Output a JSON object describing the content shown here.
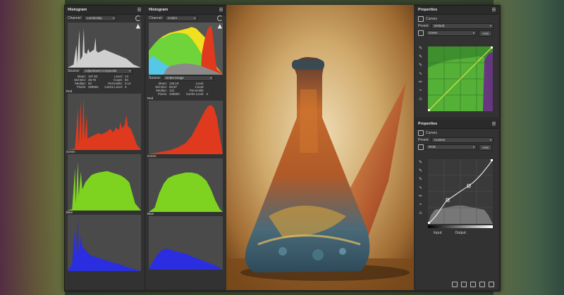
{
  "left_hist": {
    "title": "Histogram",
    "channel_label": "Channel:",
    "channel_value": "Luminosity",
    "source_label": "Source:",
    "source_value": "Adjustment Composite",
    "stats": [
      {
        "k": "Mean:",
        "v": "107.63"
      },
      {
        "k": "Level:",
        "v": "14"
      },
      {
        "k": "Std Dev:",
        "v": "48.75"
      },
      {
        "k": "Count:",
        "v": "94"
      },
      {
        "k": "Median:",
        "v": "93"
      },
      {
        "k": "Percentile:",
        "v": "0.14"
      },
      {
        "k": "Pixels:",
        "v": "269682"
      },
      {
        "k": "Cache Level:",
        "v": "3"
      }
    ],
    "red_label": "Red",
    "green_label": "Green",
    "blue_label": "Blue"
  },
  "mid_hist": {
    "title": "Histogram",
    "channel_label": "Channel:",
    "channel_value": "Colors",
    "source_label": "Source:",
    "source_value": "Entire Image",
    "stats": [
      {
        "k": "Mean:",
        "v": "126.18"
      },
      {
        "k": "Level:",
        "v": ""
      },
      {
        "k": "Std Dev:",
        "v": "50.87"
      },
      {
        "k": "Count:",
        "v": ""
      },
      {
        "k": "Median:",
        "v": "121"
      },
      {
        "k": "Percentile:",
        "v": ""
      },
      {
        "k": "Pixels:",
        "v": "345600"
      },
      {
        "k": "Cache Level:",
        "v": "4"
      }
    ],
    "red_label": "Red",
    "green_label": "Green",
    "blue_label": "Blue"
  },
  "props_top": {
    "title": "Properties",
    "sub": "Curves",
    "preset_label": "Preset:",
    "preset_value": "Default",
    "channel_value": "Green",
    "auto_label": "Auto"
  },
  "props_bottom": {
    "title": "Properties",
    "sub": "Curves",
    "preset_label": "Preset:",
    "preset_value": "Custom",
    "channel_value": "RGB",
    "auto_label": "Auto",
    "input_label": "Input:",
    "output_label": "Output:"
  },
  "colors": {
    "red": "#e03a1e",
    "green": "#7ed321",
    "blue": "#2a2ee0",
    "curve_green_bg": "#3e8f2e",
    "curve_line": "#d8e84a"
  },
  "icons": [
    "menu-icon",
    "refresh-icon",
    "warning-icon",
    "eyedropper-icon",
    "pencil-icon",
    "curve-icon",
    "trash-icon",
    "eye-icon",
    "reset-icon",
    "clip-icon"
  ]
}
